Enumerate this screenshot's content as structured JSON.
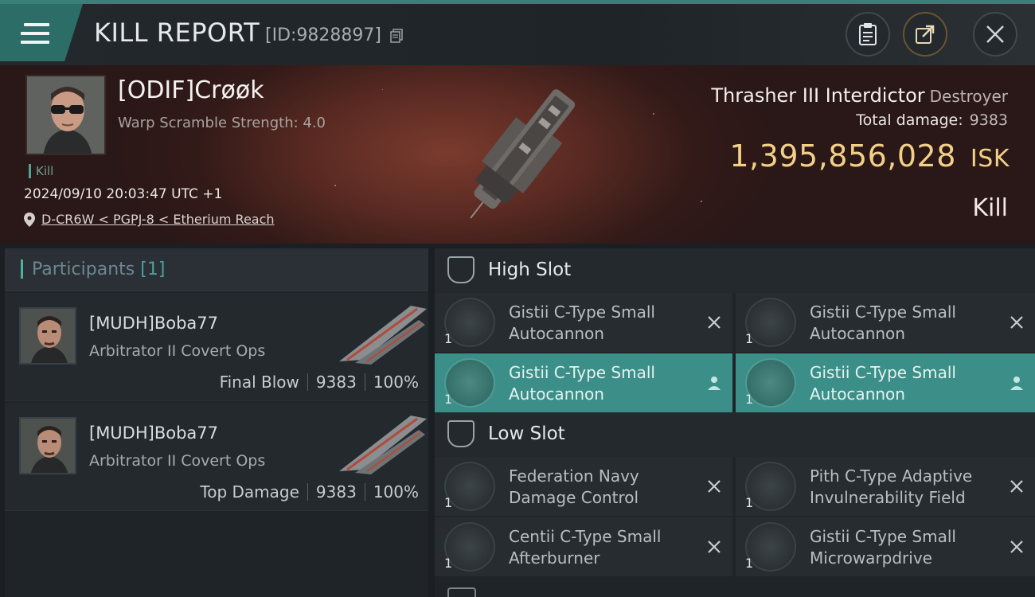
{
  "header": {
    "title": "KILL REPORT",
    "report_id": "[ID:9828897]"
  },
  "kill": {
    "pilot_name": "[ODIF]Crøøk",
    "warp_scramble": "Warp Scramble Strength: 4.0",
    "tag": "Kill",
    "date": "2024/09/10 20:03:47 UTC +1",
    "location": "D-CR6W < PGPJ-8 < Etherium Reach",
    "ship_name": "Thrasher III Interdictor",
    "ship_class": "Destroyer",
    "total_damage_label": "Total damage:",
    "total_damage": "9383",
    "isk_value": "1,395,856,028",
    "isk_unit": "ISK",
    "result": "Kill"
  },
  "participants": {
    "title": "Participants",
    "count": "[1]",
    "rows": [
      {
        "name": "[MUDH]Boba77",
        "ship": "Arbitrator II Covert Ops",
        "role": "Final Blow",
        "damage": "9383",
        "percent": "100%"
      },
      {
        "name": "[MUDH]Boba77",
        "ship": "Arbitrator II Covert Ops",
        "role": "Top Damage",
        "damage": "9383",
        "percent": "100%"
      }
    ]
  },
  "slots": {
    "high": {
      "label": "High Slot",
      "modules": [
        {
          "line1": "Gistii C-Type Small",
          "line2": "Autocannon",
          "qty": "1",
          "state": "destroyed"
        },
        {
          "line1": "Gistii C-Type Small",
          "line2": "Autocannon",
          "qty": "1",
          "state": "destroyed"
        },
        {
          "line1": "Gistii C-Type Small",
          "line2": "Autocannon",
          "qty": "1",
          "state": "dropped"
        },
        {
          "line1": "Gistii C-Type Small",
          "line2": "Autocannon",
          "qty": "1",
          "state": "dropped"
        }
      ]
    },
    "low": {
      "label": "Low Slot",
      "modules": [
        {
          "line1": "Federation Navy",
          "line2": "Damage Control",
          "qty": "1",
          "state": "destroyed"
        },
        {
          "line1": "Pith C-Type Adaptive",
          "line2": "Invulnerability Field",
          "qty": "1",
          "state": "destroyed"
        },
        {
          "line1": "Centii C-Type Small",
          "line2": "Afterburner",
          "qty": "1",
          "state": "destroyed"
        },
        {
          "line1": "Gistii C-Type Small",
          "line2": "Microwarpdrive",
          "qty": "1",
          "state": "destroyed"
        }
      ]
    }
  },
  "colors": {
    "accent": "#3c8f88",
    "isk": "#f2d087",
    "header_teal": "#2d6d68"
  }
}
